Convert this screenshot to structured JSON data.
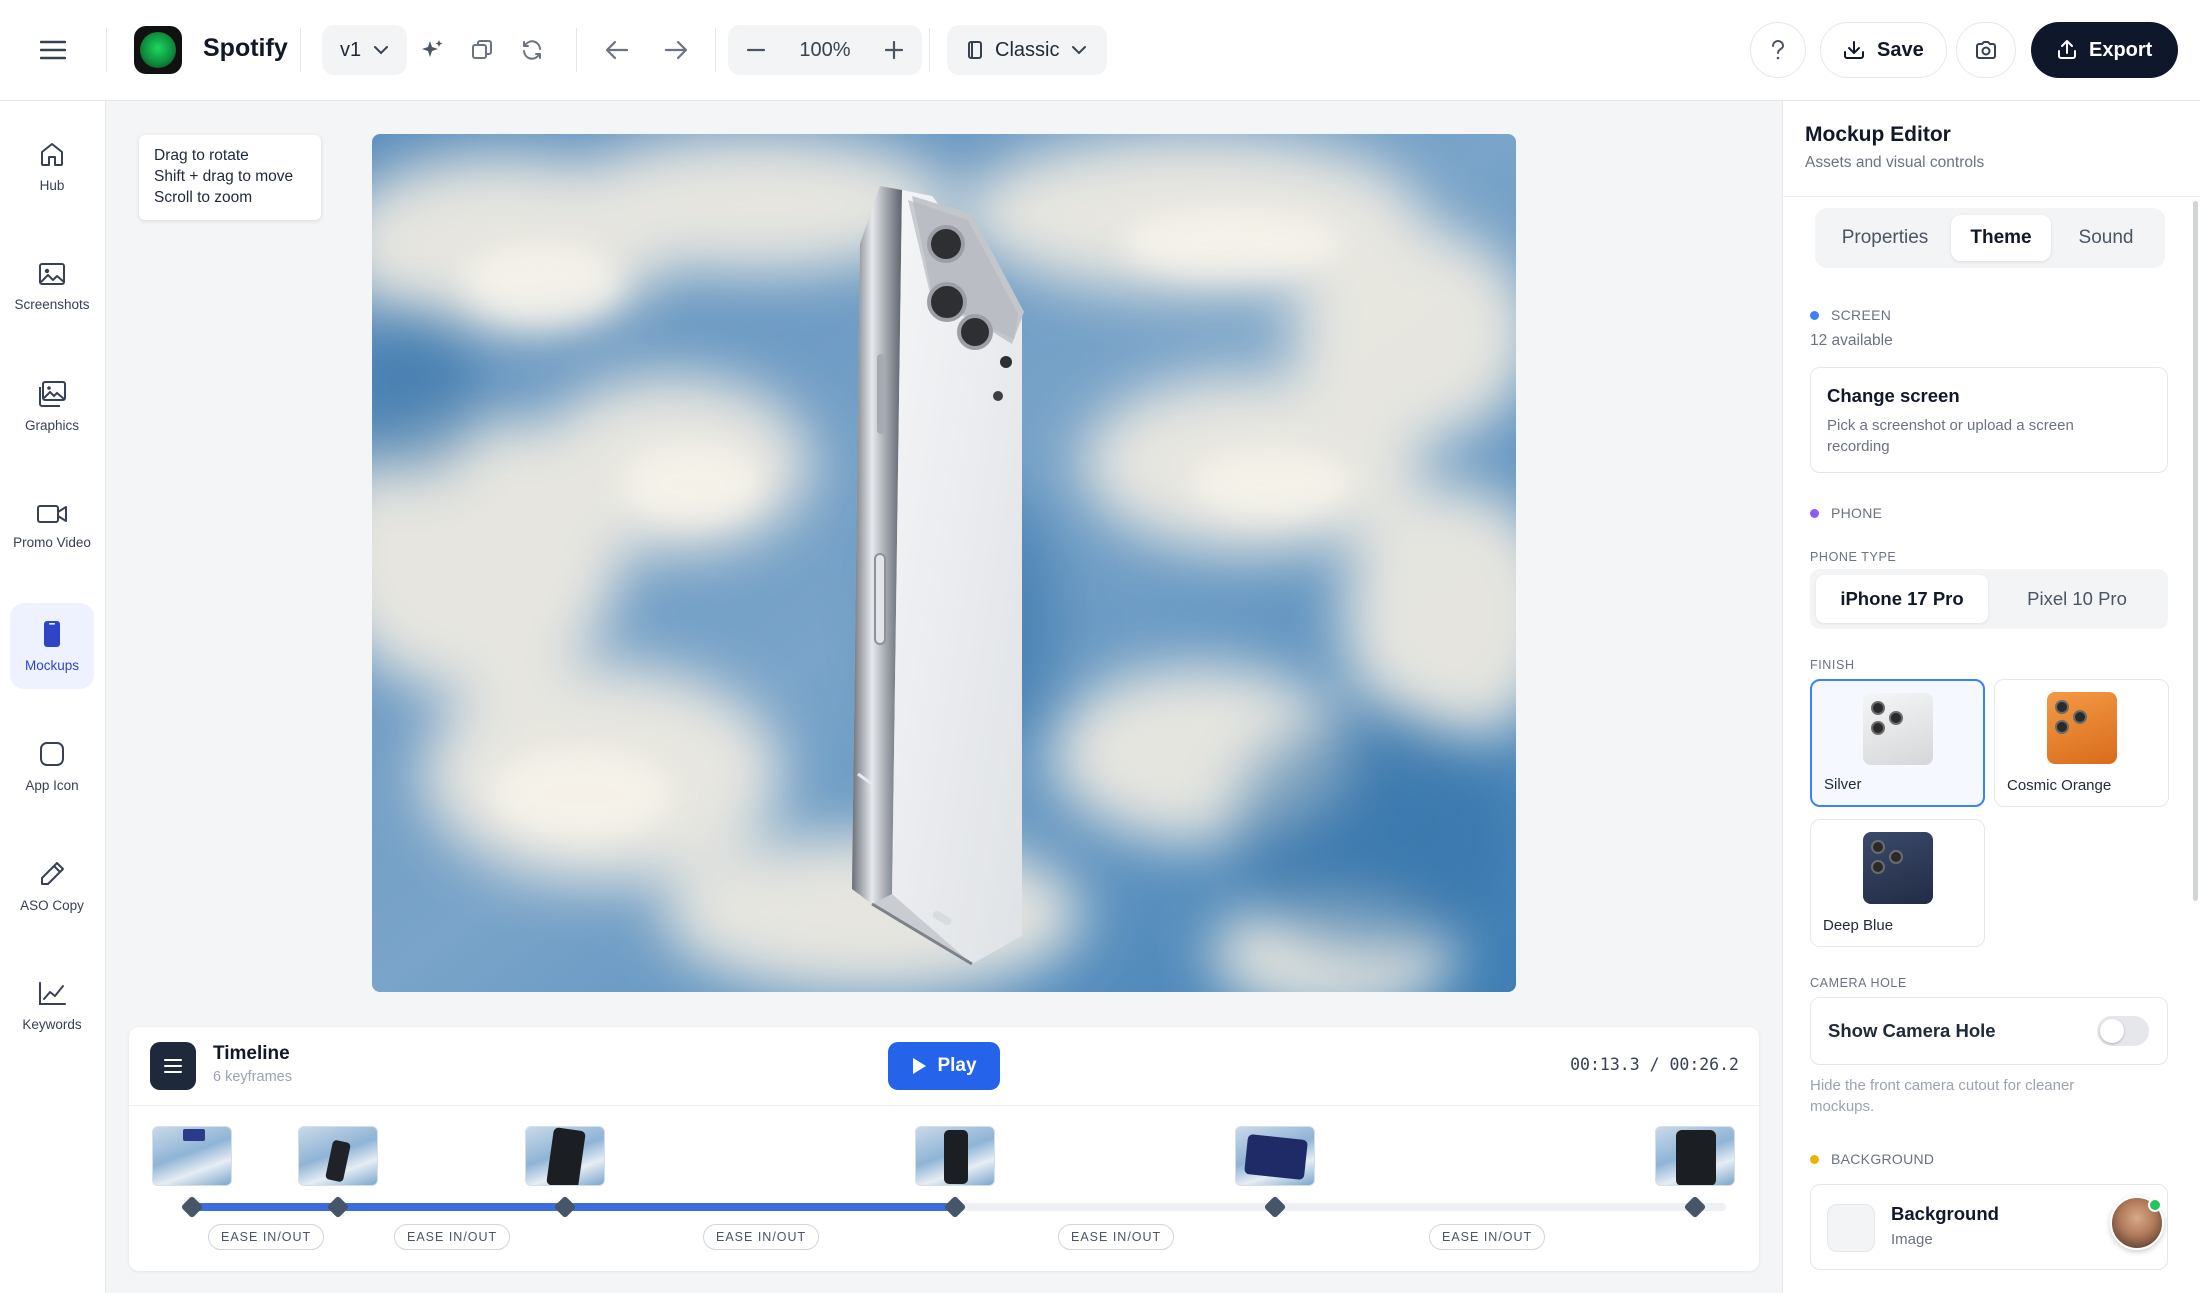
{
  "app": {
    "name": "Spotify",
    "version": "v1",
    "zoom": "100%",
    "view_mode": "Classic",
    "save_label": "Save",
    "export_label": "Export"
  },
  "nav": {
    "items": [
      {
        "label": "Hub",
        "icon": "home-icon"
      },
      {
        "label": "Screenshots",
        "icon": "image-icon"
      },
      {
        "label": "Graphics",
        "icon": "images-icon"
      },
      {
        "label": "Promo Video",
        "icon": "video-icon"
      },
      {
        "label": "Mockups",
        "icon": "phone-icon",
        "active": true
      },
      {
        "label": "App Icon",
        "icon": "app-icon"
      },
      {
        "label": "ASO Copy",
        "icon": "pen-icon"
      },
      {
        "label": "Keywords",
        "icon": "chart-line-icon"
      }
    ]
  },
  "canvas": {
    "hint_lines": [
      "Drag to rotate",
      "Shift + drag to move",
      "Scroll to zoom"
    ]
  },
  "timeline": {
    "title": "Timeline",
    "subtitle": "6 keyframes",
    "play_label": "Play",
    "time": "00:13.3 / 00:26.2",
    "ease_labels": [
      "EASE IN/OUT",
      "EASE IN/OUT",
      "EASE IN/OUT",
      "EASE IN/OUT",
      "EASE IN/OUT"
    ]
  },
  "panel": {
    "title": "Mockup Editor",
    "subtitle": "Assets and visual controls",
    "tabs": [
      "Properties",
      "Theme",
      "Sound"
    ],
    "active_tab": "Theme",
    "screen": {
      "heading": "SCREEN",
      "count": "12 available",
      "change_title": "Change screen",
      "change_desc": "Pick a screenshot or upload a screen recording"
    },
    "phone": {
      "heading": "PHONE",
      "type_label": "PHONE TYPE",
      "types": [
        "iPhone 17 Pro",
        "Pixel 10 Pro"
      ],
      "active_type": "iPhone 17 Pro",
      "finish_label": "FINISH",
      "finishes": [
        "Silver",
        "Cosmic Orange",
        "Deep Blue"
      ],
      "active_finish": "Silver"
    },
    "camera_hole": {
      "label": "CAMERA HOLE",
      "toggle_label": "Show Camera Hole",
      "enabled": false,
      "desc": "Hide the front camera cutout for cleaner mockups."
    },
    "background": {
      "heading": "BACKGROUND",
      "title": "Background",
      "subtitle": "Image"
    }
  },
  "colors": {
    "accent": "#2563eb",
    "screen_dot": "#3b82f6",
    "phone_dot": "#8b5cf6",
    "background_dot": "#eab308",
    "export_bg": "#0f172a"
  }
}
